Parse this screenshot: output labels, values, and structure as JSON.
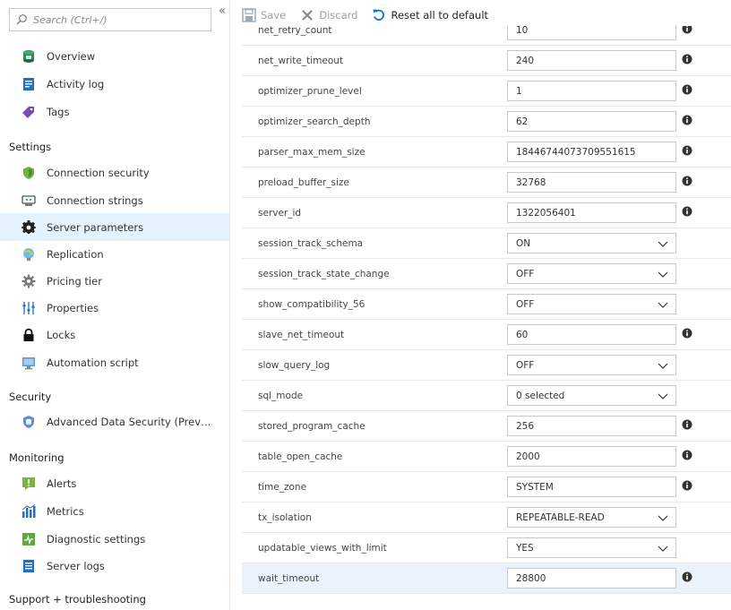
{
  "sidebar": {
    "search": {
      "placeholder": "Search (Ctrl+/)",
      "value": ""
    },
    "collapse_glyph": "«",
    "top_items": [
      {
        "label": "Overview",
        "icon": "overview-icon"
      },
      {
        "label": "Activity log",
        "icon": "activity-log-icon"
      },
      {
        "label": "Tags",
        "icon": "tag-icon"
      }
    ],
    "sections": [
      {
        "title": "Settings",
        "items": [
          {
            "label": "Connection security",
            "icon": "shield-icon"
          },
          {
            "label": "Connection strings",
            "icon": "connection-strings-icon"
          },
          {
            "label": "Server parameters",
            "icon": "gear-icon",
            "active": true
          },
          {
            "label": "Replication",
            "icon": "replication-icon"
          },
          {
            "label": "Pricing tier",
            "icon": "pricing-tier-icon"
          },
          {
            "label": "Properties",
            "icon": "properties-icon"
          },
          {
            "label": "Locks",
            "icon": "lock-icon"
          },
          {
            "label": "Automation script",
            "icon": "automation-script-icon"
          }
        ]
      },
      {
        "title": "Security",
        "items": [
          {
            "label": "Advanced Data Security (Previe...",
            "icon": "data-security-icon"
          }
        ]
      },
      {
        "title": "Monitoring",
        "items": [
          {
            "label": "Alerts",
            "icon": "alerts-icon"
          },
          {
            "label": "Metrics",
            "icon": "metrics-icon"
          },
          {
            "label": "Diagnostic settings",
            "icon": "diagnostic-settings-icon"
          },
          {
            "label": "Server logs",
            "icon": "server-logs-icon"
          }
        ]
      },
      {
        "title": "Support + troubleshooting",
        "items": []
      }
    ]
  },
  "toolbar": {
    "save_label": "Save",
    "discard_label": "Discard",
    "reset_label": "Reset all to default"
  },
  "parameters": [
    {
      "name": "net_retry_count",
      "type": "text",
      "value": "10",
      "info": true
    },
    {
      "name": "net_write_timeout",
      "type": "text",
      "value": "240",
      "info": true
    },
    {
      "name": "optimizer_prune_level",
      "type": "text",
      "value": "1",
      "info": true
    },
    {
      "name": "optimizer_search_depth",
      "type": "text",
      "value": "62",
      "info": true
    },
    {
      "name": "parser_max_mem_size",
      "type": "text",
      "value": "18446744073709551615",
      "info": true
    },
    {
      "name": "preload_buffer_size",
      "type": "text",
      "value": "32768",
      "info": true
    },
    {
      "name": "server_id",
      "type": "text",
      "value": "1322056401",
      "info": true
    },
    {
      "name": "session_track_schema",
      "type": "select",
      "value": "ON",
      "info": false
    },
    {
      "name": "session_track_state_change",
      "type": "select",
      "value": "OFF",
      "info": false
    },
    {
      "name": "show_compatibility_56",
      "type": "select",
      "value": "OFF",
      "info": false
    },
    {
      "name": "slave_net_timeout",
      "type": "text",
      "value": "60",
      "info": true
    },
    {
      "name": "slow_query_log",
      "type": "select",
      "value": "OFF",
      "info": false
    },
    {
      "name": "sql_mode",
      "type": "select",
      "value": "0 selected",
      "info": false
    },
    {
      "name": "stored_program_cache",
      "type": "text",
      "value": "256",
      "info": true
    },
    {
      "name": "table_open_cache",
      "type": "text",
      "value": "2000",
      "info": true
    },
    {
      "name": "time_zone",
      "type": "text",
      "value": "SYSTEM",
      "info": true
    },
    {
      "name": "tx_isolation",
      "type": "select",
      "value": "REPEATABLE-READ",
      "info": false
    },
    {
      "name": "updatable_views_with_limit",
      "type": "select",
      "value": "YES",
      "info": false
    },
    {
      "name": "wait_timeout",
      "type": "text",
      "value": "28800",
      "info": true,
      "highlighted": true
    }
  ],
  "colors": {
    "active_nav_bg": "#e5f1fb",
    "highlight_row_bg": "#eaf3fb",
    "accent_blue": "#0078d4",
    "disabled_text": "#a0a0a0"
  }
}
